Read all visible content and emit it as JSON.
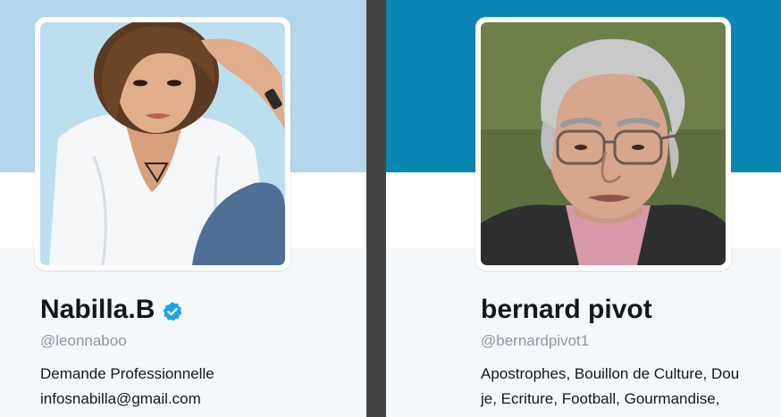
{
  "profiles": [
    {
      "name": "Nabilla.B",
      "handle": "@leonnaboo",
      "verified": true,
      "bio_lines": [
        "Demande Professionnelle",
        "infosnabilla@gmail.com"
      ],
      "banner_color": "#b3d6ea"
    },
    {
      "name": "bernard pivot",
      "handle": "@bernardpivot1",
      "verified": false,
      "bio_lines": [
        "Apostrophes, Bouillon de Culture, Dou",
        "je, Ecriture, Football, Gourmandise,"
      ],
      "banner_color": "#0a86b4"
    }
  ],
  "colors": {
    "verified_badge": "#1da1f2",
    "divider": "#444444"
  }
}
